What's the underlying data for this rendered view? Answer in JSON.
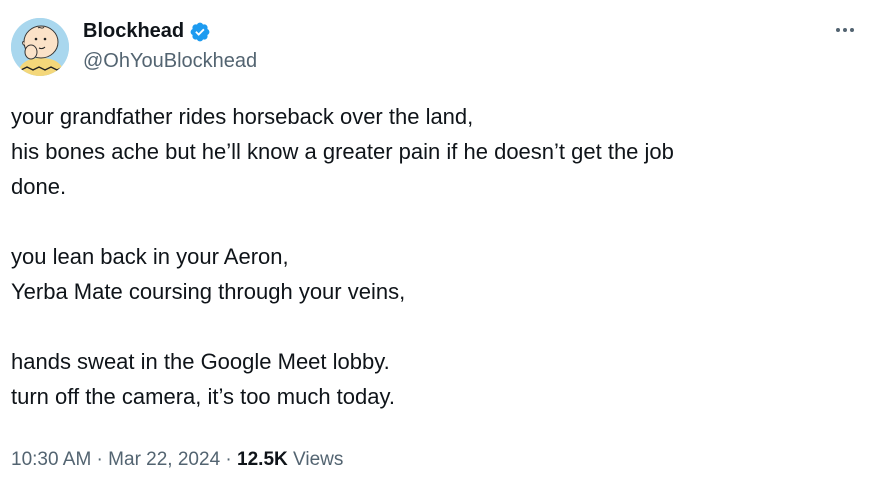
{
  "author": {
    "display_name": "Blockhead",
    "handle": "@OhYouBlockhead",
    "verified": true,
    "avatar": "charlie-brown-avatar"
  },
  "tweet": {
    "stanzas": [
      [
        "your grandfather rides horseback over the land,",
        "his bones ache but he’ll know a greater pain if he doesn’t get the job",
        "done."
      ],
      [
        "you lean back in your Aeron,",
        "Yerba Mate coursing through your veins,"
      ],
      [
        "hands sweat in the Google Meet lobby.",
        "turn off the camera, it’s too much today."
      ]
    ]
  },
  "meta": {
    "time": "10:30 AM",
    "separator": " · ",
    "date": "Mar 22, 2024",
    "views_count": "12.5K",
    "views_label": " Views"
  },
  "icons": {
    "verified": "verified-badge-icon",
    "more": "more-options-icon"
  },
  "colors": {
    "text": "#0f1419",
    "secondary": "#536471",
    "verified": "#1d9bf0"
  }
}
